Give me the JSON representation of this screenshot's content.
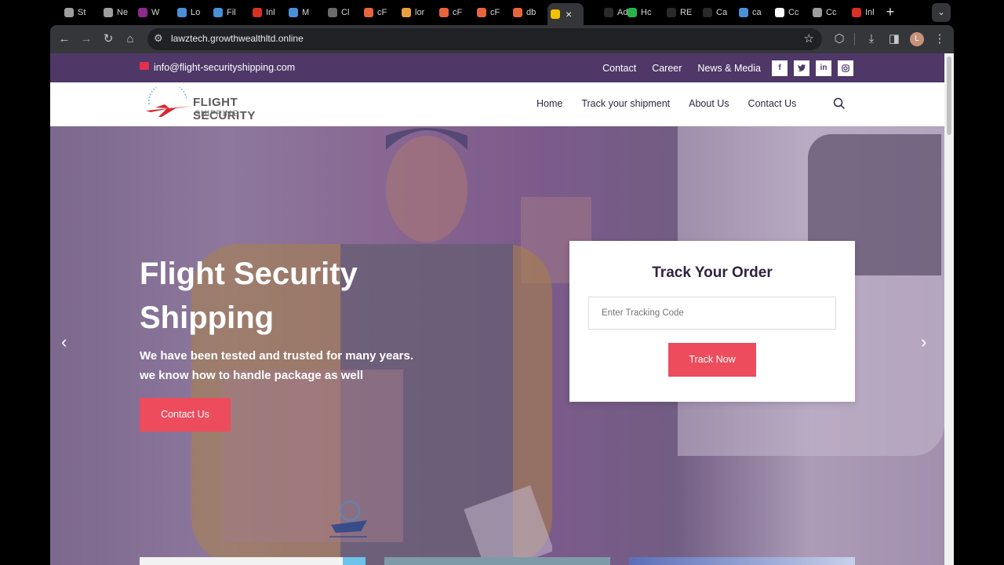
{
  "browser": {
    "tabs": [
      {
        "label": "St",
        "color": "#9e9e9e"
      },
      {
        "label": "Ne",
        "color": "#9e9e9e"
      },
      {
        "label": "W",
        "color": "#8b2a8b"
      },
      {
        "label": "Lo",
        "color": "#4a90d9"
      },
      {
        "label": "Fil",
        "color": "#4a90d9"
      },
      {
        "label": "Inl",
        "color": "#d93025"
      },
      {
        "label": "M",
        "color": "#4a90d9"
      },
      {
        "label": "Cl",
        "color": "#6a6a6a"
      },
      {
        "label": "cF",
        "color": "#e8643c"
      },
      {
        "label": "lor",
        "color": "#e8a03c"
      },
      {
        "label": "cF",
        "color": "#e8643c"
      },
      {
        "label": "cF",
        "color": "#e8643c"
      },
      {
        "label": "db",
        "color": "#e8643c"
      },
      {
        "label": "",
        "color": "#f2c200",
        "active": true
      },
      {
        "label": "Ad",
        "color": "#2a2a2a"
      },
      {
        "label": "Hc",
        "color": "#2ab24a"
      },
      {
        "label": "RE",
        "color": "#2a2a2a"
      },
      {
        "label": "Ca",
        "color": "#2a2a2a"
      },
      {
        "label": "ca",
        "color": "#4a90d9"
      },
      {
        "label": "Cc",
        "color": "#ffffff"
      },
      {
        "label": "Cc",
        "color": "#9e9e9e"
      },
      {
        "label": "Inl",
        "color": "#d93025"
      }
    ],
    "url": "lawztech.growthwealthltd.online",
    "profile_initial": "L"
  },
  "topbar": {
    "email": "info@flight-securityshipping.com",
    "links": [
      "Contact",
      "Career",
      "News & Media"
    ],
    "socials": [
      "f",
      "t",
      "in",
      "ig"
    ]
  },
  "nav": {
    "logo_line1": "FLIGHT SECURITY",
    "logo_line2": "SHIPPING",
    "links": [
      "Home",
      "Track your shipment",
      "About Us",
      "Contact Us"
    ]
  },
  "hero": {
    "title": "Flight Security Shipping",
    "subtitle": "We have been tested and trusted for many years. we know how to handle package as well",
    "button": "Contact Us",
    "prev_arrow": "‹",
    "next_arrow": "›"
  },
  "track": {
    "title": "Track Your Order",
    "placeholder": "Enter Tracking Code",
    "button": "Track Now"
  },
  "colors": {
    "brand_purple": "#4f3768",
    "accent_red": "#ed4c5c"
  }
}
